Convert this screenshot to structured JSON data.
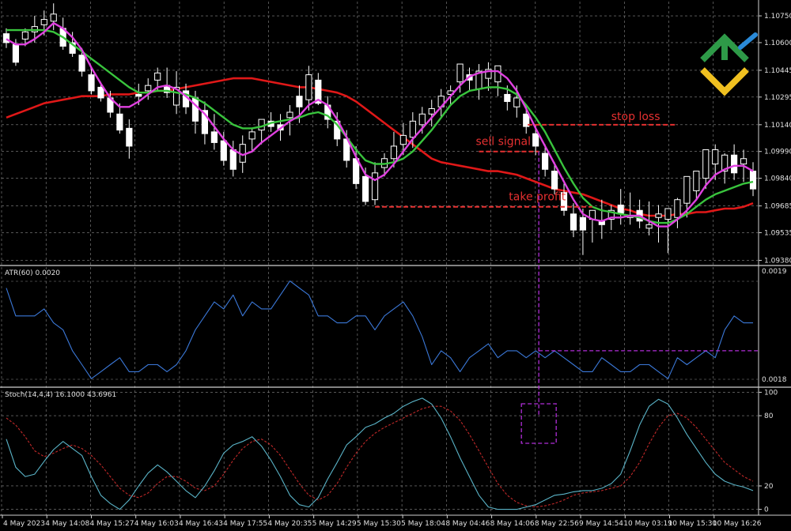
{
  "colors": {
    "background": "#000000",
    "grid": "#8a8a8a",
    "candle": "#ffffff",
    "ma_long": "#e01818",
    "ma_medium": "#39c43d",
    "ma_fast": "#e040e0",
    "atr_line": "#3b78d8",
    "stoch_main": "#5ab4c8",
    "stoch_signal": "#c02828",
    "annotation": "#e53030",
    "marker": "#b02dd8"
  },
  "logo": {
    "name": "litefinance-logo-icon"
  },
  "chart_data": [
    {
      "type": "candlestick",
      "panel": "price",
      "yticks": [
        "1.10750",
        "1.10600",
        "1.10445",
        "1.10295",
        "1.10140",
        "1.09990",
        "1.09840",
        "1.09685",
        "1.09535",
        "1.09380"
      ],
      "ylim": [
        1.0936,
        1.1083
      ],
      "candles": [
        [
          1.1065,
          1.1068,
          1.1057,
          1.106
        ],
        [
          1.1059,
          1.1062,
          1.1047,
          1.1049
        ],
        [
          1.1062,
          1.1068,
          1.1058,
          1.1066
        ],
        [
          1.1066,
          1.1075,
          1.106,
          1.1069
        ],
        [
          1.107,
          1.1078,
          1.1064,
          1.1073
        ],
        [
          1.1072,
          1.1082,
          1.1067,
          1.1076
        ],
        [
          1.1068,
          1.1074,
          1.1056,
          1.1058
        ],
        [
          1.106,
          1.1066,
          1.1052,
          1.1054
        ],
        [
          1.1053,
          1.1057,
          1.1041,
          1.1044
        ],
        [
          1.1042,
          1.1046,
          1.1031,
          1.1033
        ],
        [
          1.1035,
          1.1038,
          1.1027,
          1.1029
        ],
        [
          1.1029,
          1.1033,
          1.1018,
          1.1021
        ],
        [
          1.102,
          1.1026,
          1.1009,
          1.1011
        ],
        [
          1.1012,
          1.1017,
          1.0995,
          1.1002
        ],
        [
          1.1031,
          1.1037,
          1.1025,
          1.103
        ],
        [
          1.1033,
          1.104,
          1.1028,
          1.1036
        ],
        [
          1.1039,
          1.1046,
          1.1033,
          1.1043
        ],
        [
          1.1036,
          1.1046,
          1.1029,
          1.1032
        ],
        [
          1.1025,
          1.1044,
          1.102,
          1.1035
        ],
        [
          1.1033,
          1.1037,
          1.102,
          1.1024
        ],
        [
          1.1029,
          1.1033,
          1.1009,
          1.1016
        ],
        [
          1.1022,
          1.1027,
          1.1003,
          1.1009
        ],
        [
          1.101,
          1.102,
          1.1,
          1.1004
        ],
        [
          1.1005,
          1.101,
          1.0991,
          1.0994
        ],
        [
          1.1,
          1.1005,
          1.0985,
          1.0989
        ],
        [
          1.0993,
          1.1008,
          1.0987,
          1.1003
        ],
        [
          1.1006,
          1.1012,
          1.0999,
          1.101
        ],
        [
          1.1011,
          1.1016,
          1.1003,
          1.1017
        ],
        [
          1.1016,
          1.1021,
          1.101,
          1.1013
        ],
        [
          1.1014,
          1.102,
          1.1005,
          1.1011
        ],
        [
          1.1018,
          1.1025,
          1.1008,
          1.1021
        ],
        [
          1.103,
          1.1036,
          1.1015,
          1.1024
        ],
        [
          1.1028,
          1.1047,
          1.1022,
          1.1042
        ],
        [
          1.1039,
          1.1043,
          1.1025,
          1.1026
        ],
        [
          1.1025,
          1.103,
          1.1012,
          1.1017
        ],
        [
          1.1016,
          1.1021,
          1.1002,
          1.1006
        ],
        [
          1.1006,
          1.1011,
          1.099,
          1.0994
        ],
        [
          1.0995,
          1.1002,
          1.0978,
          1.0981
        ],
        [
          1.0985,
          1.099,
          1.0969,
          1.0971
        ],
        [
          1.0972,
          1.0993,
          1.0969,
          1.0987
        ],
        [
          1.099,
          1.0998,
          1.0985,
          1.0995
        ],
        [
          1.0995,
          1.101,
          1.099,
          1.1002
        ],
        [
          1.1003,
          1.1015,
          1.0997,
          1.1008
        ],
        [
          1.1007,
          1.1021,
          1.1001,
          1.1016
        ],
        [
          1.1014,
          1.1024,
          1.1009,
          1.102
        ],
        [
          1.102,
          1.1028,
          1.1013,
          1.1023
        ],
        [
          1.1024,
          1.1034,
          1.1018,
          1.103
        ],
        [
          1.1031,
          1.1036,
          1.1025,
          1.1033
        ],
        [
          1.1038,
          1.1046,
          1.1032,
          1.1048
        ],
        [
          1.1042,
          1.1046,
          1.1033,
          1.1039
        ],
        [
          1.1034,
          1.1048,
          1.1028,
          1.1044
        ],
        [
          1.104,
          1.1049,
          1.1033,
          1.1045
        ],
        [
          1.1038,
          1.1047,
          1.103,
          1.1047
        ],
        [
          1.1031,
          1.1036,
          1.1022,
          1.1027
        ],
        [
          1.1024,
          1.1036,
          1.1018,
          1.1029
        ],
        [
          1.102,
          1.1025,
          1.1009,
          1.1013
        ],
        [
          1.1009,
          1.1014,
          1.0997,
          1.1002
        ],
        [
          1.0998,
          1.1003,
          1.0985,
          1.0989
        ],
        [
          1.0988,
          1.0993,
          1.0975,
          1.0978
        ],
        [
          1.0976,
          1.0981,
          1.0963,
          1.0966
        ],
        [
          1.0964,
          1.097,
          1.0951,
          1.0955
        ],
        [
          1.0962,
          1.0967,
          1.0941,
          1.0955
        ],
        [
          1.0961,
          1.0966,
          1.0948,
          1.0966
        ],
        [
          1.096,
          1.0972,
          1.095,
          1.0958
        ],
        [
          1.0961,
          1.0969,
          1.0955,
          1.0966
        ],
        [
          1.0969,
          1.0978,
          1.0958,
          1.0964
        ],
        [
          1.0962,
          1.0976,
          1.0958,
          1.0963
        ],
        [
          1.0966,
          1.0972,
          1.0956,
          1.096
        ],
        [
          1.0956,
          1.0971,
          1.0952,
          1.0958
        ],
        [
          1.0962,
          1.0969,
          1.0948,
          1.0964
        ],
        [
          1.0961,
          1.0967,
          1.0942,
          1.0967
        ],
        [
          1.0962,
          1.0973,
          1.0956,
          1.0972
        ],
        [
          1.097,
          1.0977,
          1.0962,
          1.0985
        ],
        [
          1.0977,
          1.0987,
          1.0972,
          1.0988
        ],
        [
          1.0984,
          1.0994,
          1.0978,
          1.1
        ],
        [
          1.0992,
          1.1003,
          1.0983,
          1.1
        ],
        [
          1.0988,
          1.0998,
          1.0981,
          1.0997
        ],
        [
          1.0997,
          1.1003,
          1.0983,
          1.0987
        ],
        [
          1.0992,
          1.1,
          1.0982,
          1.0995
        ],
        [
          1.0988,
          1.0993,
          1.0974,
          1.0978
        ]
      ],
      "ma_long": [
        1.1018,
        1.102,
        1.1022,
        1.1024,
        1.1026,
        1.1027,
        1.1028,
        1.1029,
        1.103,
        1.103,
        1.103,
        1.1031,
        1.1031,
        1.1031,
        1.1032,
        1.1032,
        1.1033,
        1.1033,
        1.1034,
        1.1035,
        1.1036,
        1.1037,
        1.1038,
        1.1039,
        1.104,
        1.104,
        1.104,
        1.1039,
        1.1038,
        1.1037,
        1.1036,
        1.1035,
        1.1035,
        1.1034,
        1.1033,
        1.1032,
        1.103,
        1.1027,
        1.1023,
        1.1019,
        1.1015,
        1.1011,
        1.1007,
        1.1003,
        1.0999,
        1.0995,
        1.0993,
        1.0992,
        1.0991,
        1.099,
        1.0989,
        1.0988,
        1.0988,
        1.0987,
        1.0986,
        1.0984,
        1.0982,
        1.098,
        1.0978,
        1.0977,
        1.0976,
        1.0975,
        1.0973,
        1.0971,
        1.0969,
        1.0967,
        1.0966,
        1.0964,
        1.0963,
        1.0963,
        1.0963,
        1.0964,
        1.0964,
        1.0965,
        1.0965,
        1.0966,
        1.0967,
        1.0967,
        1.0968,
        1.097
      ],
      "ma_medium": [
        1.1067,
        1.1067,
        1.1067,
        1.1067,
        1.1067,
        1.1066,
        1.1063,
        1.1059,
        1.1055,
        1.1051,
        1.1047,
        1.1043,
        1.1039,
        1.1035,
        1.1032,
        1.1032,
        1.1033,
        1.1033,
        1.1032,
        1.1031,
        1.1029,
        1.1026,
        1.1022,
        1.1018,
        1.1014,
        1.1012,
        1.1012,
        1.1013,
        1.1015,
        1.1016,
        1.1017,
        1.1018,
        1.102,
        1.1021,
        1.1019,
        1.1014,
        1.1007,
        1.1,
        1.0994,
        1.0992,
        1.0992,
        1.0993,
        1.0995,
        1.0999,
        1.1005,
        1.1011,
        1.1018,
        1.1025,
        1.103,
        1.1033,
        1.1034,
        1.1035,
        1.1035,
        1.1034,
        1.1031,
        1.1025,
        1.1018,
        1.101,
        1.1,
        1.099,
        1.0981,
        1.0973,
        1.0968,
        1.0966,
        1.0965,
        1.0964,
        1.0963,
        1.0962,
        1.096,
        1.0959,
        1.0959,
        1.0961,
        1.0964,
        1.0968,
        1.0972,
        1.0975,
        1.0977,
        1.0979,
        1.0981,
        1.0982
      ],
      "ma_fast": [
        1.1062,
        1.1059,
        1.1059,
        1.1062,
        1.1066,
        1.1071,
        1.1068,
        1.1063,
        1.1056,
        1.1046,
        1.1037,
        1.1029,
        1.1024,
        1.1024,
        1.1027,
        1.1031,
        1.1035,
        1.1036,
        1.1034,
        1.103,
        1.1025,
        1.102,
        1.1013,
        1.1006,
        1.1,
        1.0997,
        1.0999,
        1.1004,
        1.1008,
        1.1012,
        1.1016,
        1.1019,
        1.1025,
        1.1028,
        1.1025,
        1.1017,
        1.1007,
        1.0996,
        1.0986,
        1.0983,
        1.0986,
        1.0992,
        1.0999,
        1.1006,
        1.1012,
        1.1018,
        1.1024,
        1.103,
        1.1036,
        1.1041,
        1.1043,
        1.1044,
        1.1044,
        1.104,
        1.1033,
        1.1023,
        1.1012,
        1.1002,
        1.0992,
        1.0982,
        1.0972,
        1.0964,
        1.0961,
        1.096,
        1.0962,
        1.0962,
        1.0963,
        1.0963,
        1.096,
        1.0957,
        1.0957,
        1.0961,
        1.0966,
        1.0972,
        1.098,
        1.0986,
        1.0989,
        1.0991,
        1.0991,
        1.0988
      ],
      "annotations": [
        {
          "text": "stop loss",
          "price": 1.1014
        },
        {
          "text": "sell signal",
          "price": 1.0999
        },
        {
          "text": "take profit",
          "price": 1.0968
        }
      ]
    },
    {
      "type": "line",
      "panel": "atr",
      "title": "ATR(60) 0.0020",
      "ytick_top": "0.0019",
      "ytick_bottom": "0.0018",
      "ylim": [
        0.00178,
        0.00195
      ],
      "values": [
        0.00192,
        0.00188,
        0.00188,
        0.00188,
        0.00189,
        0.00187,
        0.00186,
        0.00183,
        0.00181,
        0.00179,
        0.0018,
        0.00181,
        0.00182,
        0.0018,
        0.0018,
        0.00181,
        0.00181,
        0.0018,
        0.00181,
        0.00183,
        0.00186,
        0.00188,
        0.0019,
        0.00189,
        0.00191,
        0.00188,
        0.0019,
        0.00189,
        0.00189,
        0.00191,
        0.00193,
        0.00192,
        0.00191,
        0.00188,
        0.00188,
        0.00187,
        0.00187,
        0.00188,
        0.00188,
        0.00186,
        0.00188,
        0.00189,
        0.0019,
        0.00188,
        0.00185,
        0.00181,
        0.00183,
        0.00182,
        0.0018,
        0.00182,
        0.00183,
        0.00184,
        0.00182,
        0.00183,
        0.00183,
        0.00182,
        0.00183,
        0.00182,
        0.00183,
        0.00182,
        0.00181,
        0.0018,
        0.0018,
        0.00182,
        0.00181,
        0.0018,
        0.0018,
        0.00181,
        0.00181,
        0.0018,
        0.00179,
        0.00182,
        0.00181,
        0.00182,
        0.00183,
        0.00182,
        0.00186,
        0.00188,
        0.00187,
        0.00187
      ],
      "marker_level": 0.00183
    },
    {
      "type": "line",
      "panel": "stochastic",
      "title": "Stoch(14,4,4) 16.1000 43.6961",
      "yticks": [
        100,
        80,
        20,
        0
      ],
      "ylim": [
        -5,
        103
      ],
      "main": [
        60,
        36,
        28,
        30,
        41,
        51,
        58,
        52,
        46,
        28,
        12,
        5,
        0,
        8,
        20,
        31,
        38,
        32,
        24,
        16,
        10,
        20,
        33,
        48,
        55,
        58,
        62,
        54,
        42,
        28,
        12,
        4,
        2,
        10,
        26,
        40,
        55,
        62,
        70,
        73,
        78,
        82,
        88,
        92,
        95,
        90,
        78,
        62,
        44,
        28,
        12,
        2,
        0,
        0,
        0,
        2,
        4,
        8,
        12,
        13,
        15,
        16,
        16,
        18,
        22,
        30,
        50,
        72,
        88,
        94,
        90,
        78,
        64,
        52,
        40,
        30,
        24,
        21,
        19,
        16
      ],
      "signal": [
        78,
        72,
        62,
        50,
        45,
        48,
        52,
        55,
        52,
        46,
        38,
        28,
        18,
        12,
        10,
        14,
        22,
        28,
        28,
        24,
        18,
        16,
        20,
        30,
        42,
        52,
        58,
        60,
        55,
        46,
        34,
        22,
        12,
        8,
        12,
        22,
        36,
        48,
        58,
        65,
        70,
        74,
        78,
        82,
        86,
        88,
        88,
        84,
        76,
        64,
        50,
        36,
        22,
        12,
        6,
        3,
        2,
        3,
        5,
        8,
        12,
        14,
        15,
        16,
        18,
        20,
        28,
        40,
        56,
        70,
        80,
        82,
        78,
        70,
        60,
        50,
        40,
        34,
        28,
        24
      ]
    }
  ],
  "x_axis_labels": [
    "4 May 2023",
    "4 May 14:08",
    "4 May 15:27",
    "4 May 16:03",
    "4 May 16:43",
    "4 May 17:55",
    "4 May 20:35",
    "5 May 14:29",
    "5 May 15:30",
    "5 May 18:04",
    "8 May 04:46",
    "8 May 14:06",
    "8 May 22:56",
    "9 May 14:54",
    "10 May 03:19",
    "10 May 15:30",
    "10 May 16:26"
  ],
  "signal_index": 56
}
